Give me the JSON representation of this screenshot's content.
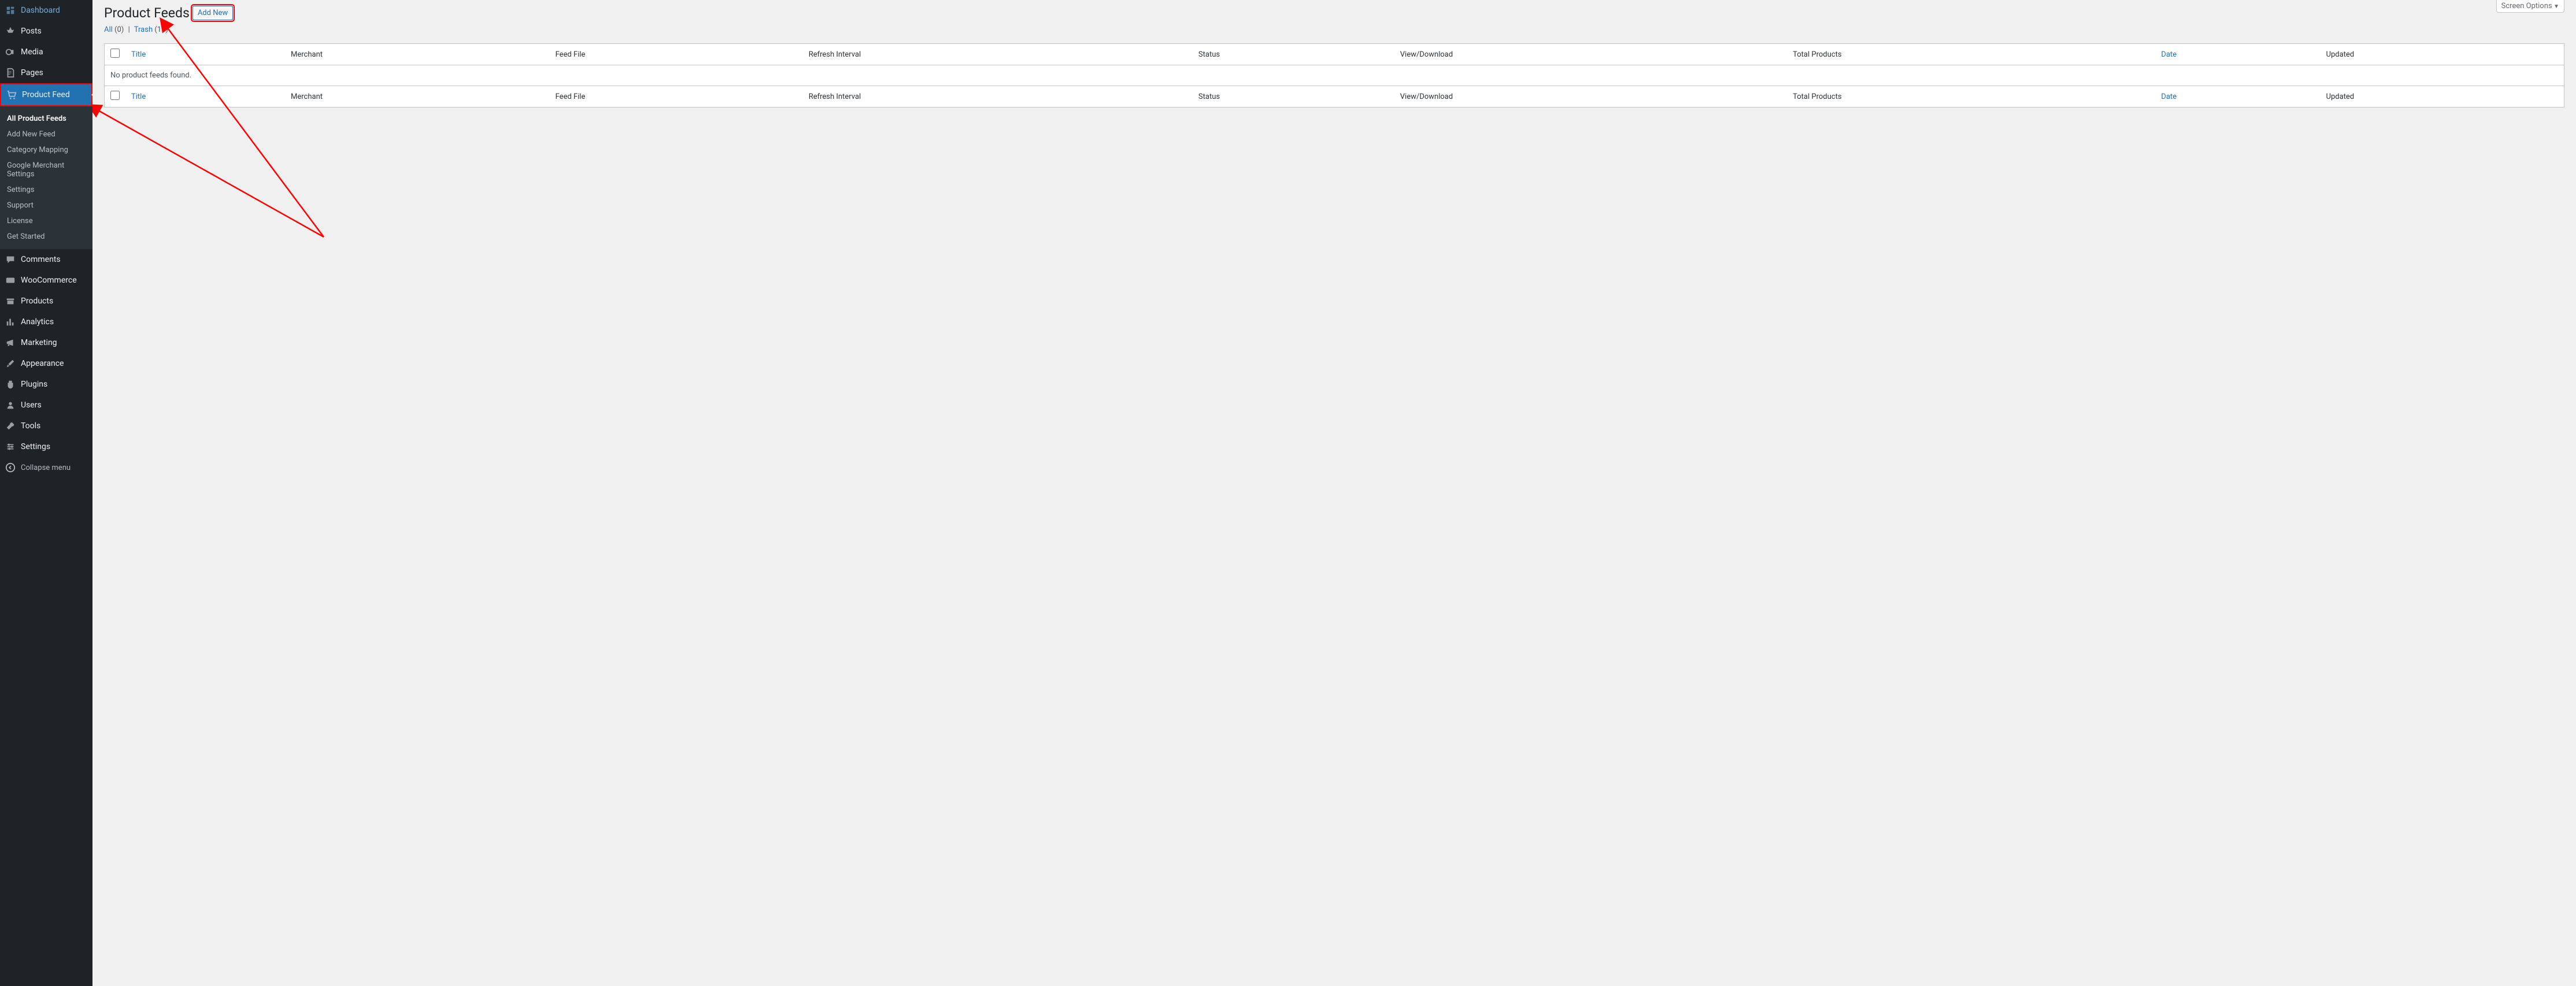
{
  "sidebar": {
    "items": [
      {
        "label": "Dashboard",
        "icon": "dashboard"
      },
      {
        "label": "Posts",
        "icon": "pin"
      },
      {
        "label": "Media",
        "icon": "media"
      },
      {
        "label": "Pages",
        "icon": "pages"
      },
      {
        "label": "Product Feed",
        "icon": "cart",
        "active": true
      },
      {
        "label": "Comments",
        "icon": "comment"
      },
      {
        "label": "WooCommerce",
        "icon": "woo"
      },
      {
        "label": "Products",
        "icon": "archive"
      },
      {
        "label": "Analytics",
        "icon": "analytics"
      },
      {
        "label": "Marketing",
        "icon": "megaphone"
      },
      {
        "label": "Appearance",
        "icon": "brush"
      },
      {
        "label": "Plugins",
        "icon": "plugin"
      },
      {
        "label": "Users",
        "icon": "users"
      },
      {
        "label": "Tools",
        "icon": "tools"
      },
      {
        "label": "Settings",
        "icon": "settings"
      }
    ],
    "submenu": [
      {
        "label": "All Product Feeds",
        "current": true
      },
      {
        "label": "Add New Feed"
      },
      {
        "label": "Category Mapping"
      },
      {
        "label": "Google Merchant Settings"
      },
      {
        "label": "Settings"
      },
      {
        "label": "Support"
      },
      {
        "label": "License"
      },
      {
        "label": "Get Started"
      }
    ],
    "collapse": "Collapse menu"
  },
  "header": {
    "title": "Product Feeds",
    "add_new": "Add New",
    "screen_options": "Screen Options"
  },
  "filters": {
    "all_label": "All",
    "all_count": "(0)",
    "trash_label": "Trash",
    "trash_count": "(11)"
  },
  "table": {
    "columns": {
      "title": "Title",
      "merchant": "Merchant",
      "feed_file": "Feed File",
      "refresh": "Refresh Interval",
      "status": "Status",
      "view": "View/Download",
      "total": "Total Products",
      "date": "Date",
      "updated": "Updated"
    },
    "empty": "No product feeds found."
  }
}
